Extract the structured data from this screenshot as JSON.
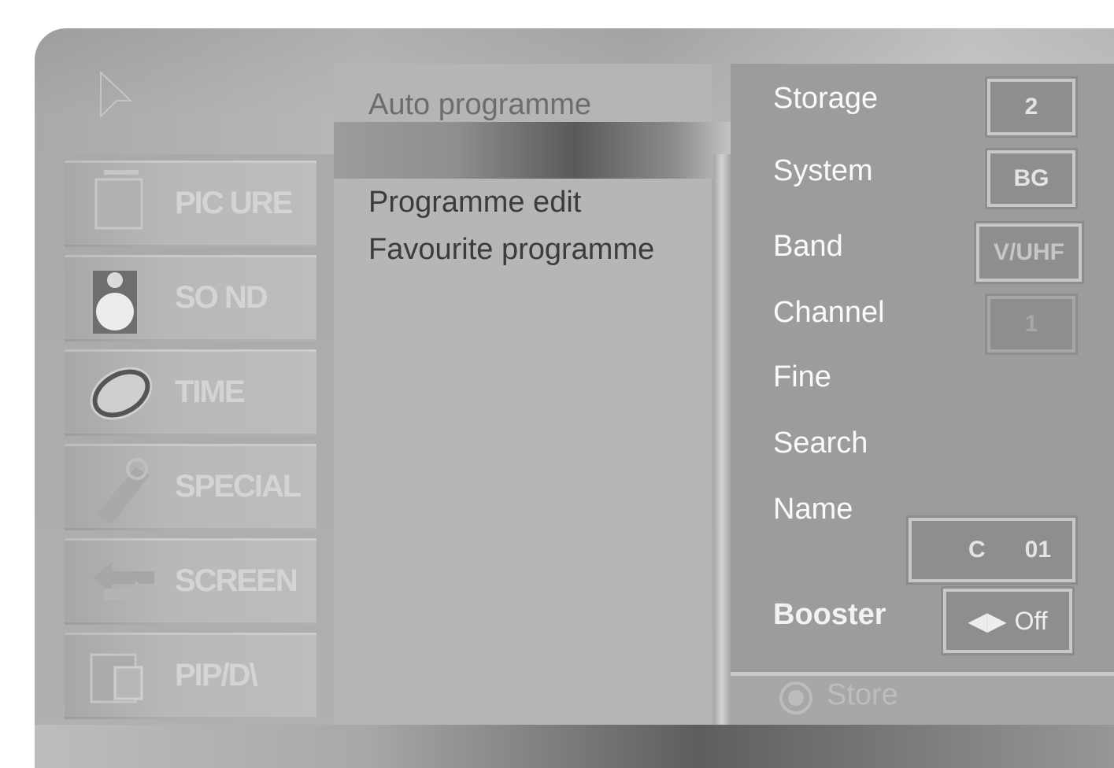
{
  "categories": [
    {
      "label": "PIC URE",
      "icon": "picture-icon"
    },
    {
      "label": "SO ND",
      "icon": "sound-icon"
    },
    {
      "label": "TIME",
      "icon": "time-icon"
    },
    {
      "label": "SPECIAL",
      "icon": "special-icon"
    },
    {
      "label": "SCREEN",
      "icon": "screen-icon"
    },
    {
      "label": "PIP/D\\",
      "icon": "pip-icon"
    }
  ],
  "submenu": {
    "items": [
      "Auto programme",
      "Programme edit",
      "Favourite programme"
    ]
  },
  "settings": {
    "storage": {
      "label": "Storage",
      "value": "2"
    },
    "system": {
      "label": "System",
      "value": "BG"
    },
    "band": {
      "label": "Band",
      "value": "V/UHF"
    },
    "channel": {
      "label": "Channel",
      "value": "1"
    },
    "fine": {
      "label": "Fine"
    },
    "search": {
      "label": "Search"
    },
    "name": {
      "label": "Name",
      "value_prefix": "C",
      "value_number": "01"
    },
    "booster": {
      "label": "Booster",
      "arrows": "◀▶",
      "value": "Off"
    }
  },
  "store": {
    "label": "Store",
    "icon": "ok-button-icon"
  }
}
